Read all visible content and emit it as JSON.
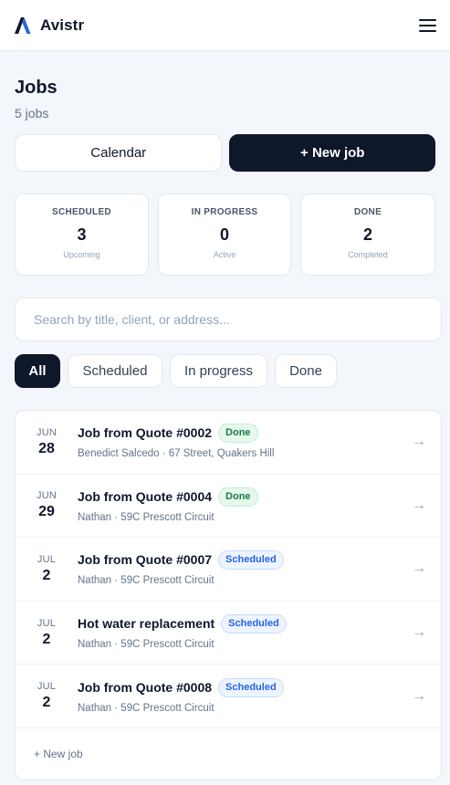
{
  "app": {
    "brand_name": "Avistr",
    "icons": {
      "logo": "avistr-logo-icon",
      "menu": "hamburger-menu-icon",
      "arrow": "arrow-right-icon"
    }
  },
  "page": {
    "title": "Jobs",
    "subtitle": "5 jobs"
  },
  "actions": {
    "calendar_label": "Calendar",
    "new_job_label": "+ New job"
  },
  "stats": [
    {
      "label": "SCHEDULED",
      "value": "3",
      "caption": "Upcoming"
    },
    {
      "label": "IN PROGRESS",
      "value": "0",
      "caption": "Active"
    },
    {
      "label": "DONE",
      "value": "2",
      "caption": "Completed"
    }
  ],
  "search": {
    "placeholder": "Search by title, client, or address...",
    "value": ""
  },
  "filters": [
    {
      "label": "All",
      "active": true
    },
    {
      "label": "Scheduled",
      "active": false
    },
    {
      "label": "In progress",
      "active": false
    },
    {
      "label": "Done",
      "active": false
    }
  ],
  "jobs": [
    {
      "month": "JUN",
      "day": "28",
      "title": "Job from Quote #0002",
      "status": "Done",
      "client_address": "Benedict Salcedo · 67 Street, Quakers Hill"
    },
    {
      "month": "JUN",
      "day": "29",
      "title": "Job from Quote #0004",
      "status": "Done",
      "client_address": "Nathan · 59C Prescott Circuit"
    },
    {
      "month": "JUL",
      "day": "2",
      "title": "Job from Quote #0007",
      "status": "Scheduled",
      "client_address": "Nathan · 59C Prescott Circuit"
    },
    {
      "month": "JUL",
      "day": "2",
      "title": "Hot water replacement",
      "status": "Scheduled",
      "client_address": "Nathan · 59C Prescott Circuit"
    },
    {
      "month": "JUL",
      "day": "2",
      "title": "Job from Quote #0008",
      "status": "Scheduled",
      "client_address": "Nathan · 59C Prescott Circuit"
    }
  ],
  "list_footer": {
    "new_job_label": "+ New job"
  },
  "arrow_glyph": "→",
  "colors": {
    "primary": "#0f172a",
    "logo_dark": "#0f172a",
    "logo_accent": "#2563eb",
    "done_text": "#15803d",
    "scheduled_text": "#2563eb",
    "background": "#f3f6fa"
  }
}
